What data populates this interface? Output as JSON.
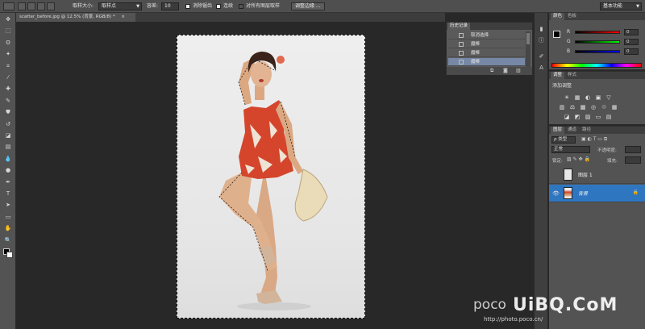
{
  "options_bar": {
    "sample_size_label": "取样大小:",
    "sample_size_value": "取样点",
    "tolerance_label": "容差:",
    "tolerance_value": "10",
    "antialias_label": "消除锯齿",
    "contiguous_label": "连续",
    "sample_all_label": "对所有图层取样",
    "refine_edge_label": "调整边缘 ...",
    "workspace_value": "基本功能"
  },
  "document": {
    "tab_title": "scatter_before.jpg @ 12.5% (背景, RGB/8) *",
    "close": "×"
  },
  "toolbar": {
    "icons": [
      "move-icon",
      "marquee-icon",
      "lasso-icon",
      "magic-wand-icon",
      "crop-icon",
      "eyedropper-icon",
      "healing-icon",
      "brush-icon",
      "stamp-icon",
      "history-brush-icon",
      "eraser-icon",
      "gradient-icon",
      "blur-icon",
      "dodge-icon",
      "pen-icon",
      "type-icon",
      "path-select-icon",
      "shape-icon",
      "hand-icon",
      "zoom-icon"
    ],
    "glyphs": [
      "✥",
      "⬚",
      "ʘ",
      "✦",
      "⌗",
      "⁄",
      "✚",
      "✎",
      "⛊",
      "↺",
      "◪",
      "▤",
      "💧",
      "●",
      "✒",
      "T",
      "➤",
      "▭",
      "✋",
      "🔍"
    ]
  },
  "history_panel": {
    "tab_label": "历史记录",
    "items": [
      {
        "label": "取消选择"
      },
      {
        "label": "魔棒"
      },
      {
        "label": "魔棒"
      },
      {
        "label": "魔棒"
      }
    ]
  },
  "color_panel": {
    "tab_color": "颜色",
    "tab_swatches": "色板",
    "rows": [
      {
        "label": "R",
        "value": "0"
      },
      {
        "label": "G",
        "value": "0"
      },
      {
        "label": "B",
        "value": "0"
      }
    ]
  },
  "adjust_panel": {
    "tab_adjust": "调整",
    "tab_styles": "样式",
    "title": "添加调整",
    "icons_row1": [
      "☀",
      "▦",
      "◐",
      "▣",
      "▽"
    ],
    "icons_row2": [
      "▥",
      "⚖",
      "▩",
      "◎",
      "♲",
      "▦"
    ],
    "icons_row3": [
      "◪",
      "◩",
      "▨",
      "▭",
      "▤"
    ]
  },
  "layers_panel": {
    "tab_layers": "图层",
    "tab_channels": "通道",
    "tab_paths": "路径",
    "filter_label": "ρ 类型",
    "blend_mode": "正常",
    "opacity_label": "不透明度:",
    "lock_label": "锁定:",
    "fill_label": "填充:",
    "layers": [
      {
        "name": "图层 1",
        "visible": false
      },
      {
        "name": "背景",
        "visible": true,
        "selected": true
      }
    ]
  },
  "watermark": {
    "left": "poco",
    "right": "UiBQ.CoM",
    "url": "http://photo.poco.cn/"
  },
  "colors": {
    "accent": "#2f76c1",
    "panel": "#535353",
    "background": "#282828"
  }
}
